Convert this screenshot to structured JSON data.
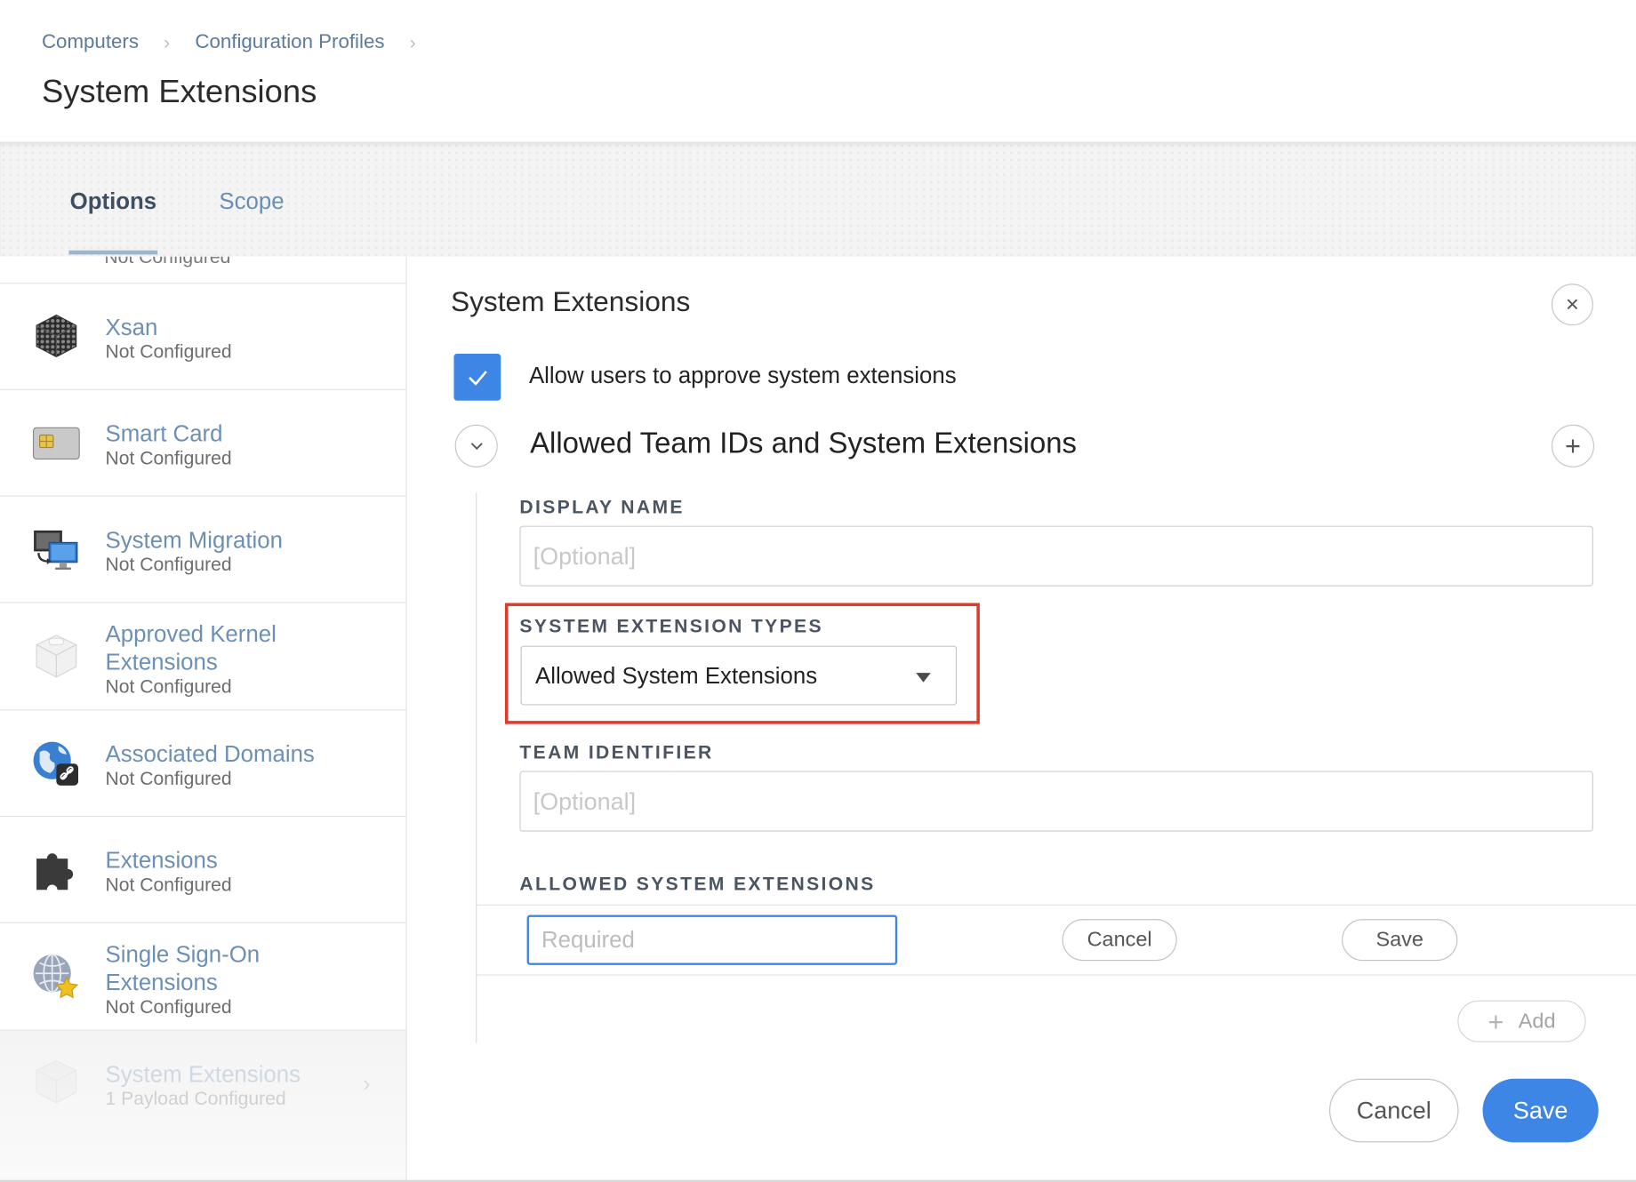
{
  "breadcrumb": {
    "items": [
      "Computers",
      "Configuration Profiles"
    ],
    "separator": "›"
  },
  "page": {
    "title": "System Extensions"
  },
  "tabs": [
    {
      "label": "Options",
      "active": true
    },
    {
      "label": "Scope",
      "active": false
    }
  ],
  "sidebar": {
    "partial_status": "Not Configured",
    "items": [
      {
        "title": "Xsan",
        "status": "Not Configured",
        "icon": "xsan-cube-icon"
      },
      {
        "title": "Smart Card",
        "status": "Not Configured",
        "icon": "smart-card-icon"
      },
      {
        "title": "System Migration",
        "status": "Not Configured",
        "icon": "system-migration-icon"
      },
      {
        "title": "Approved Kernel Extensions",
        "status": "Not Configured",
        "icon": "kernel-extension-icon"
      },
      {
        "title": "Associated Domains",
        "status": "Not Configured",
        "icon": "globe-link-icon"
      },
      {
        "title": "Extensions",
        "status": "Not Configured",
        "icon": "puzzle-piece-icon"
      },
      {
        "title": "Single Sign-On Extensions",
        "status": "Not Configured",
        "icon": "globe-key-icon"
      },
      {
        "title": "System Extensions",
        "status": "1 Payload Configured",
        "icon": "system-extension-icon",
        "selected": true
      }
    ]
  },
  "panel": {
    "title": "System Extensions",
    "close_icon": "×",
    "allow_users_label": "Allow users to approve system extensions",
    "allow_users_checked": true,
    "section_title": "Allowed Team IDs and System Extensions",
    "add_icon": "+",
    "display_name": {
      "label": "DISPLAY NAME",
      "placeholder": "[Optional]"
    },
    "extension_types": {
      "label": "SYSTEM EXTENSION TYPES",
      "selected": "Allowed System Extensions"
    },
    "team_identifier": {
      "label": "TEAM IDENTIFIER",
      "placeholder": "[Optional]"
    },
    "allowed_extensions": {
      "label": "ALLOWED SYSTEM EXTENSIONS",
      "input_placeholder": "Required",
      "cancel_label": "Cancel",
      "save_label": "Save",
      "add_label": "Add"
    }
  },
  "footer": {
    "cancel_label": "Cancel",
    "save_label": "Save"
  },
  "colors": {
    "accent": "#3e86e6",
    "link": "#6c8fb5",
    "highlight": "#e03a2a"
  }
}
